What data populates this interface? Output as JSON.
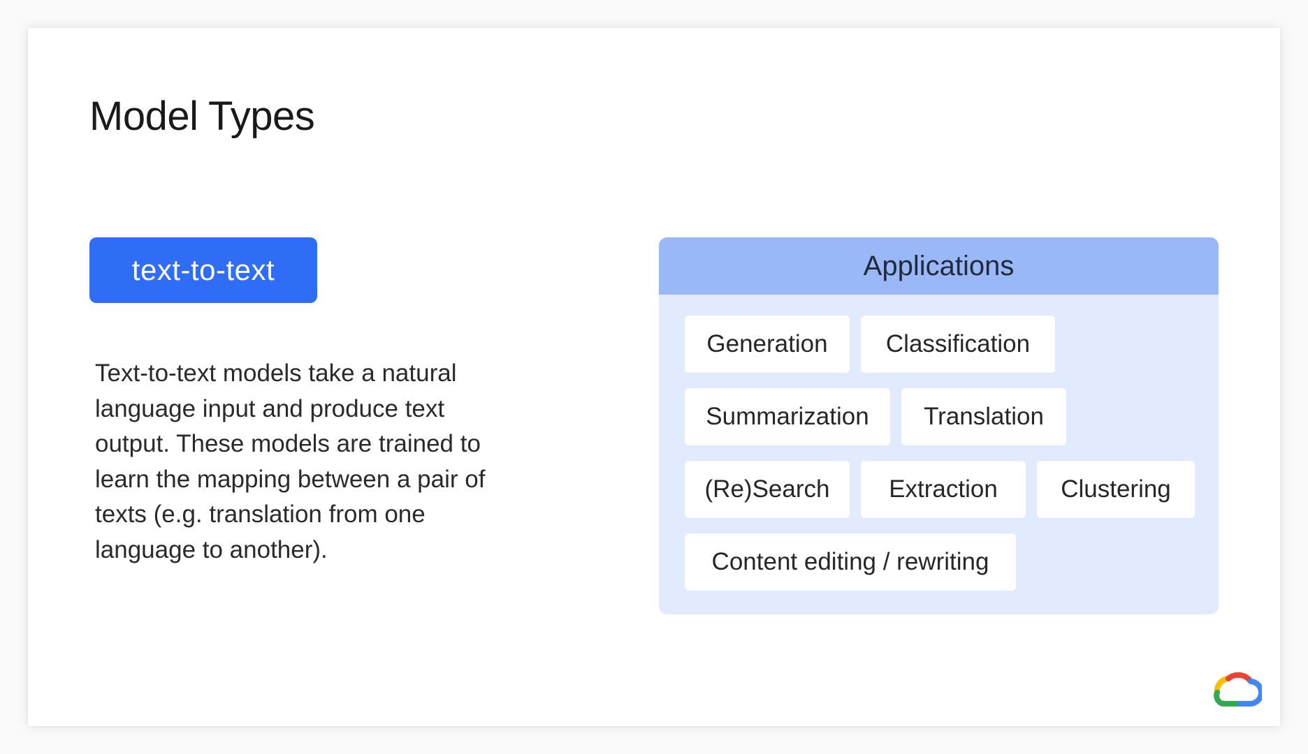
{
  "slide": {
    "title": "Model Types",
    "badge_label": "text-to-text",
    "description": "Text-to-text models take a natural language input and produce text output. These models are trained to learn the mapping between a pair of texts (e.g. translation from one language to another).",
    "applications": {
      "header": "Applications",
      "rows": [
        [
          "Generation",
          "Classification"
        ],
        [
          "Summarization",
          "Translation"
        ],
        [
          "(Re)Search",
          "Extraction",
          "Clustering"
        ],
        [
          "Content editing / rewriting"
        ]
      ]
    }
  },
  "colors": {
    "badge": "#2f6df6",
    "panel_header": "#9ab8f7",
    "panel_body": "#e1ebfd",
    "logo_red": "#ea4335",
    "logo_blue": "#4285f4",
    "logo_yellow": "#fbbc04",
    "logo_green": "#34a853"
  },
  "icons": {
    "brand_logo": "google-cloud-icon"
  }
}
